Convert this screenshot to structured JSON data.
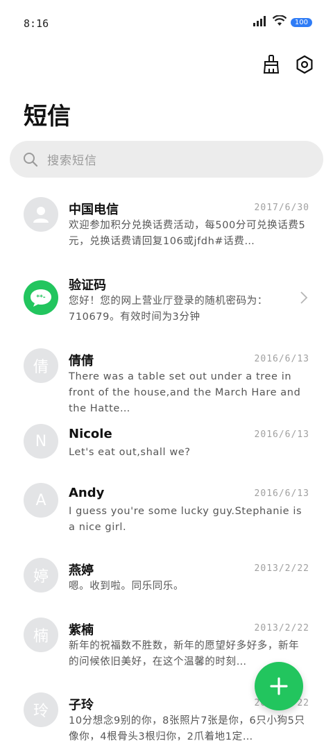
{
  "status_bar": {
    "time": "8:16",
    "battery": "100"
  },
  "header": {
    "title": "短信"
  },
  "search": {
    "placeholder": "搜索短信"
  },
  "messages": [
    {
      "name": "中国电信",
      "date": "2017/6/30",
      "avatar": "",
      "preview": "欢迎参加积分兑换话费活动，每500分可兑换话费5元，兑换话费请回复106或jfdh#话费…"
    },
    {
      "name": "验证码",
      "date": "",
      "avatar": "",
      "preview": "您好！您的网上营业厅登录的随机密码为：710679。有效时间为3分钟"
    },
    {
      "name": "倩倩",
      "date": "2016/6/13",
      "avatar": "倩",
      "preview": "There was a table set out under a tree in front of the house,and the March Hare and the Hatte…"
    },
    {
      "name": "Nicole",
      "date": "2016/6/13",
      "avatar": "N",
      "preview": "Let's eat out,shall we?"
    },
    {
      "name": "Andy",
      "date": "2016/6/13",
      "avatar": "A",
      "preview": "I guess you're some lucky guy.Stephanie is a nice girl."
    },
    {
      "name": "燕婷",
      "date": "2013/2/22",
      "avatar": "婷",
      "preview": "嗯。收到啦。同乐同乐。"
    },
    {
      "name": "紫楠",
      "date": "2013/2/22",
      "avatar": "楠",
      "preview": "新年的祝福数不胜数，新年的愿望好多好多，新年的问候依旧美好，在这个温馨的时刻…"
    },
    {
      "name": "子玲",
      "date": "2013/2/22",
      "avatar": "玲",
      "preview": "10分想念9别的你，8张照片7张是你，6只小狗5只像你，4根骨头3根归你，2爪着地1定…"
    }
  ],
  "colors": {
    "accent": "#22c55e",
    "avatar_bg": "#e3e4e6",
    "search_bg": "#ececec"
  }
}
